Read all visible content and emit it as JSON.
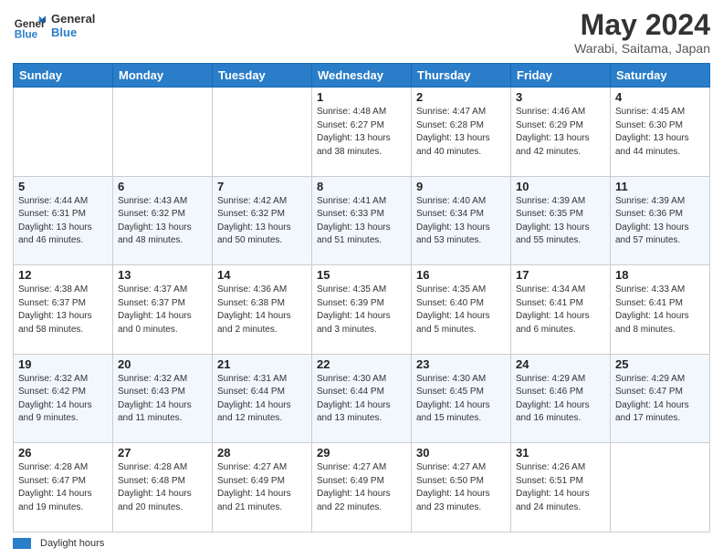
{
  "header": {
    "logo_text_general": "General",
    "logo_text_blue": "Blue",
    "title": "May 2024",
    "subtitle": "Warabi, Saitama, Japan"
  },
  "calendar": {
    "days_of_week": [
      "Sunday",
      "Monday",
      "Tuesday",
      "Wednesday",
      "Thursday",
      "Friday",
      "Saturday"
    ],
    "weeks": [
      {
        "cells": [
          {
            "day": "",
            "info": ""
          },
          {
            "day": "",
            "info": ""
          },
          {
            "day": "",
            "info": ""
          },
          {
            "day": "1",
            "info": "Sunrise: 4:48 AM\nSunset: 6:27 PM\nDaylight: 13 hours\nand 38 minutes."
          },
          {
            "day": "2",
            "info": "Sunrise: 4:47 AM\nSunset: 6:28 PM\nDaylight: 13 hours\nand 40 minutes."
          },
          {
            "day": "3",
            "info": "Sunrise: 4:46 AM\nSunset: 6:29 PM\nDaylight: 13 hours\nand 42 minutes."
          },
          {
            "day": "4",
            "info": "Sunrise: 4:45 AM\nSunset: 6:30 PM\nDaylight: 13 hours\nand 44 minutes."
          }
        ]
      },
      {
        "cells": [
          {
            "day": "5",
            "info": "Sunrise: 4:44 AM\nSunset: 6:31 PM\nDaylight: 13 hours\nand 46 minutes."
          },
          {
            "day": "6",
            "info": "Sunrise: 4:43 AM\nSunset: 6:32 PM\nDaylight: 13 hours\nand 48 minutes."
          },
          {
            "day": "7",
            "info": "Sunrise: 4:42 AM\nSunset: 6:32 PM\nDaylight: 13 hours\nand 50 minutes."
          },
          {
            "day": "8",
            "info": "Sunrise: 4:41 AM\nSunset: 6:33 PM\nDaylight: 13 hours\nand 51 minutes."
          },
          {
            "day": "9",
            "info": "Sunrise: 4:40 AM\nSunset: 6:34 PM\nDaylight: 13 hours\nand 53 minutes."
          },
          {
            "day": "10",
            "info": "Sunrise: 4:39 AM\nSunset: 6:35 PM\nDaylight: 13 hours\nand 55 minutes."
          },
          {
            "day": "11",
            "info": "Sunrise: 4:39 AM\nSunset: 6:36 PM\nDaylight: 13 hours\nand 57 minutes."
          }
        ]
      },
      {
        "cells": [
          {
            "day": "12",
            "info": "Sunrise: 4:38 AM\nSunset: 6:37 PM\nDaylight: 13 hours\nand 58 minutes."
          },
          {
            "day": "13",
            "info": "Sunrise: 4:37 AM\nSunset: 6:37 PM\nDaylight: 14 hours\nand 0 minutes."
          },
          {
            "day": "14",
            "info": "Sunrise: 4:36 AM\nSunset: 6:38 PM\nDaylight: 14 hours\nand 2 minutes."
          },
          {
            "day": "15",
            "info": "Sunrise: 4:35 AM\nSunset: 6:39 PM\nDaylight: 14 hours\nand 3 minutes."
          },
          {
            "day": "16",
            "info": "Sunrise: 4:35 AM\nSunset: 6:40 PM\nDaylight: 14 hours\nand 5 minutes."
          },
          {
            "day": "17",
            "info": "Sunrise: 4:34 AM\nSunset: 6:41 PM\nDaylight: 14 hours\nand 6 minutes."
          },
          {
            "day": "18",
            "info": "Sunrise: 4:33 AM\nSunset: 6:41 PM\nDaylight: 14 hours\nand 8 minutes."
          }
        ]
      },
      {
        "cells": [
          {
            "day": "19",
            "info": "Sunrise: 4:32 AM\nSunset: 6:42 PM\nDaylight: 14 hours\nand 9 minutes."
          },
          {
            "day": "20",
            "info": "Sunrise: 4:32 AM\nSunset: 6:43 PM\nDaylight: 14 hours\nand 11 minutes."
          },
          {
            "day": "21",
            "info": "Sunrise: 4:31 AM\nSunset: 6:44 PM\nDaylight: 14 hours\nand 12 minutes."
          },
          {
            "day": "22",
            "info": "Sunrise: 4:30 AM\nSunset: 6:44 PM\nDaylight: 14 hours\nand 13 minutes."
          },
          {
            "day": "23",
            "info": "Sunrise: 4:30 AM\nSunset: 6:45 PM\nDaylight: 14 hours\nand 15 minutes."
          },
          {
            "day": "24",
            "info": "Sunrise: 4:29 AM\nSunset: 6:46 PM\nDaylight: 14 hours\nand 16 minutes."
          },
          {
            "day": "25",
            "info": "Sunrise: 4:29 AM\nSunset: 6:47 PM\nDaylight: 14 hours\nand 17 minutes."
          }
        ]
      },
      {
        "cells": [
          {
            "day": "26",
            "info": "Sunrise: 4:28 AM\nSunset: 6:47 PM\nDaylight: 14 hours\nand 19 minutes."
          },
          {
            "day": "27",
            "info": "Sunrise: 4:28 AM\nSunset: 6:48 PM\nDaylight: 14 hours\nand 20 minutes."
          },
          {
            "day": "28",
            "info": "Sunrise: 4:27 AM\nSunset: 6:49 PM\nDaylight: 14 hours\nand 21 minutes."
          },
          {
            "day": "29",
            "info": "Sunrise: 4:27 AM\nSunset: 6:49 PM\nDaylight: 14 hours\nand 22 minutes."
          },
          {
            "day": "30",
            "info": "Sunrise: 4:27 AM\nSunset: 6:50 PM\nDaylight: 14 hours\nand 23 minutes."
          },
          {
            "day": "31",
            "info": "Sunrise: 4:26 AM\nSunset: 6:51 PM\nDaylight: 14 hours\nand 24 minutes."
          },
          {
            "day": "",
            "info": ""
          }
        ]
      }
    ]
  },
  "footer": {
    "legend_label": "Daylight hours"
  }
}
